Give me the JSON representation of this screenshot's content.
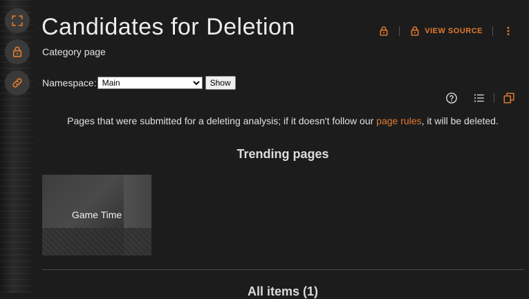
{
  "page": {
    "title": "Candidates for Deletion",
    "subtitle": "Category page"
  },
  "rail": {
    "items": [
      {
        "icon": "expand-icon"
      },
      {
        "icon": "lock-icon"
      },
      {
        "icon": "link-icon"
      }
    ]
  },
  "actions": {
    "view_source_label": "VIEW SOURCE"
  },
  "namespace": {
    "label": "Namespace:",
    "selected": "Main",
    "button_label": "Show"
  },
  "description": {
    "before": "Pages that were submitted for a deleting analysis; if it doesn't follow our ",
    "link": "page rules",
    "after": ", it will be deleted."
  },
  "trending": {
    "title": "Trending pages",
    "cards": [
      {
        "label": "Game Time"
      }
    ]
  },
  "all_items": {
    "title": "All items (1)"
  },
  "colors": {
    "accent": "#e07a2f",
    "background": "#1c1c1c",
    "rail_button": "#3a3a3a"
  }
}
